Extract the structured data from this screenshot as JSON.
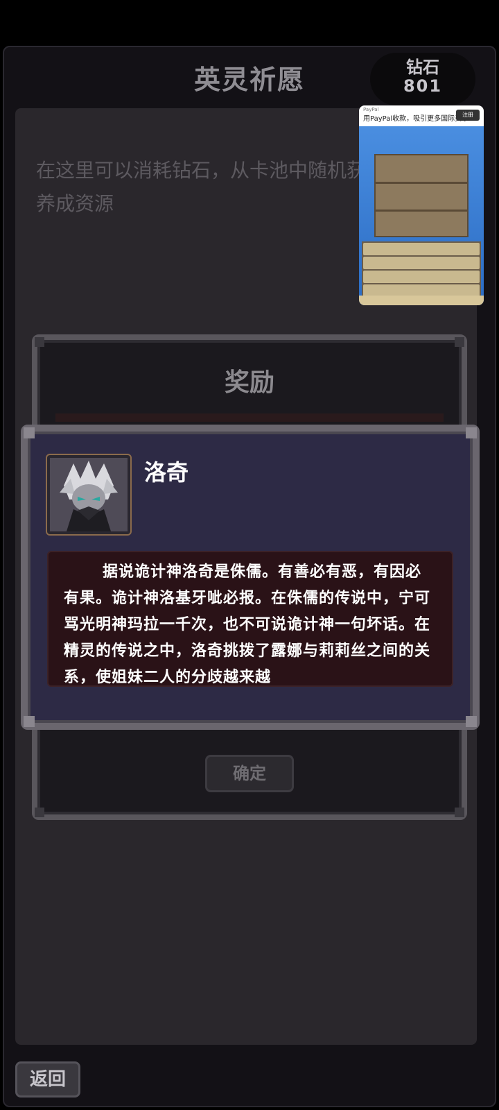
{
  "header": {
    "title": "英灵祈愿",
    "diamond_label": "钻石",
    "diamond_value": "801"
  },
  "description": "在这里可以消耗钻石，从卡池中随机获得英灵和养成资源",
  "ad": {
    "brand": "PayPal",
    "text": "用PayPal收款，吸引更多国际买家",
    "button": "注册"
  },
  "reward_dialog": {
    "title": "奖励",
    "confirm_label": "确定"
  },
  "hero_card": {
    "name": "洛奇",
    "lore": "据说诡计神洛奇是侏儒。有善必有恶，有因必有果。诡计神洛基牙呲必报。在侏儒的传说中，宁可骂光明神玛拉一千次，也不可说诡计神一句坏话。在精灵的传说之中，洛奇挑拨了露娜与莉莉丝之间的关系，使姐妹二人的分歧越来越"
  },
  "footer": {
    "back_label": "返回"
  }
}
